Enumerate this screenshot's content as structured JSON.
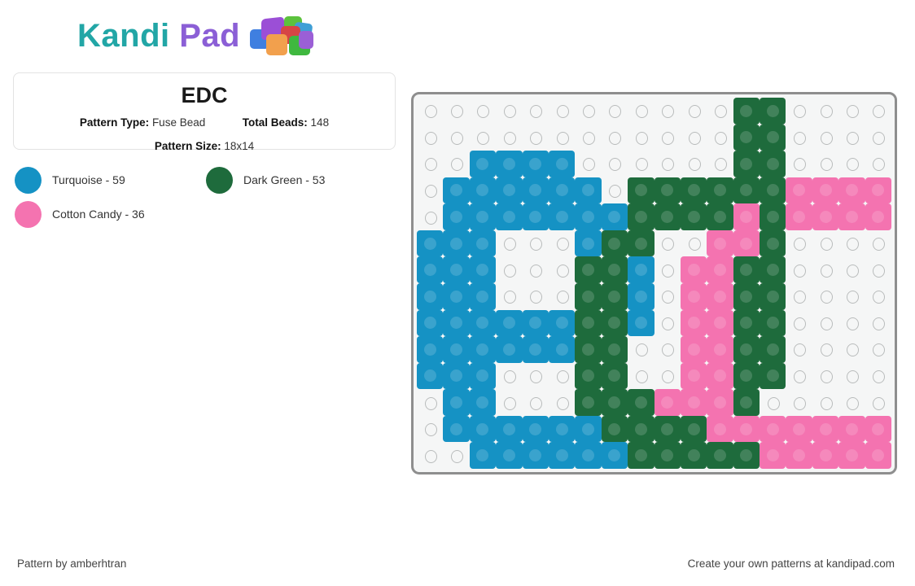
{
  "brand": {
    "name_part1": "Kandi",
    "name_part2": "Pad",
    "logo_icon": "bead-cluster-icon"
  },
  "pattern": {
    "title": "EDC",
    "type_label": "Pattern Type:",
    "type_value": "Fuse Bead",
    "total_label": "Total Beads:",
    "total_value": "148",
    "size_label": "Pattern Size:",
    "size_value": "18x14"
  },
  "legend": [
    {
      "name": "Turquoise - 59",
      "color": "#1592c4"
    },
    {
      "name": "Dark Green - 53",
      "color": "#1e6b3c"
    },
    {
      "name": "Cotton Candy - 36",
      "color": "#f473b0"
    }
  ],
  "footer": {
    "credit": "Pattern by amberhtran",
    "promo": "Create your own patterns at kandipad.com"
  },
  "grid": {
    "columns": 18,
    "rows": 14,
    "empty_color": "#f5f6f6",
    "palette": {
      "T": "#1592c4",
      "G": "#1e6b3c",
      "P": "#f473b0",
      "_": null
    },
    "cells": [
      "____________GG____",
      "____________GG____",
      "__TTTT______GG____",
      "_TTTTTT_GGGGGGPPPP",
      "_TTTTTTTGGGGPGPPPP",
      "TTT___TGG__PPG____",
      "TTT___GGT_PPGG____",
      "TTT___GGT_PPGG____",
      "TTTTTTGGT_PPGG____",
      "TTTTTTGG__PPGG____",
      "TTT___GG__PPGG____",
      "_TT___GGGPPPG_____",
      "_TTTTTTGGGGPPPPPPP",
      "__TTTTTTGGGGGPPPPP"
    ]
  }
}
